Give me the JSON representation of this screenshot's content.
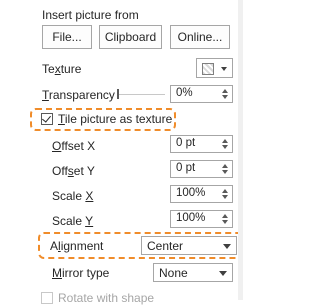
{
  "colors": {
    "highlight": "#f08c2a",
    "text": "#262626",
    "disabled": "#a6a6a6"
  },
  "insert_picture": {
    "heading": "Insert picture from",
    "file_label": "File...",
    "clipboard_label": "Clipboard",
    "online_label": "Online..."
  },
  "texture": {
    "label": "Texture",
    "icon": "texture-picker-icon"
  },
  "transparency": {
    "label": "Transparency",
    "value": "0%",
    "slider_fraction": 0.0
  },
  "tile": {
    "label": "Tile picture as texture",
    "checked": true
  },
  "offset_x": {
    "label": "Offset X",
    "value": "0 pt"
  },
  "offset_y": {
    "label": "Offset Y",
    "value": "0 pt"
  },
  "scale_x": {
    "label": "Scale X",
    "value": "100%"
  },
  "scale_y": {
    "label": "Scale Y",
    "value": "100%"
  },
  "alignment": {
    "label": "Alignment",
    "value": "Center"
  },
  "mirror": {
    "label": "Mirror type",
    "value": "None"
  },
  "rotate": {
    "label": "Rotate with shape",
    "checked": false
  }
}
